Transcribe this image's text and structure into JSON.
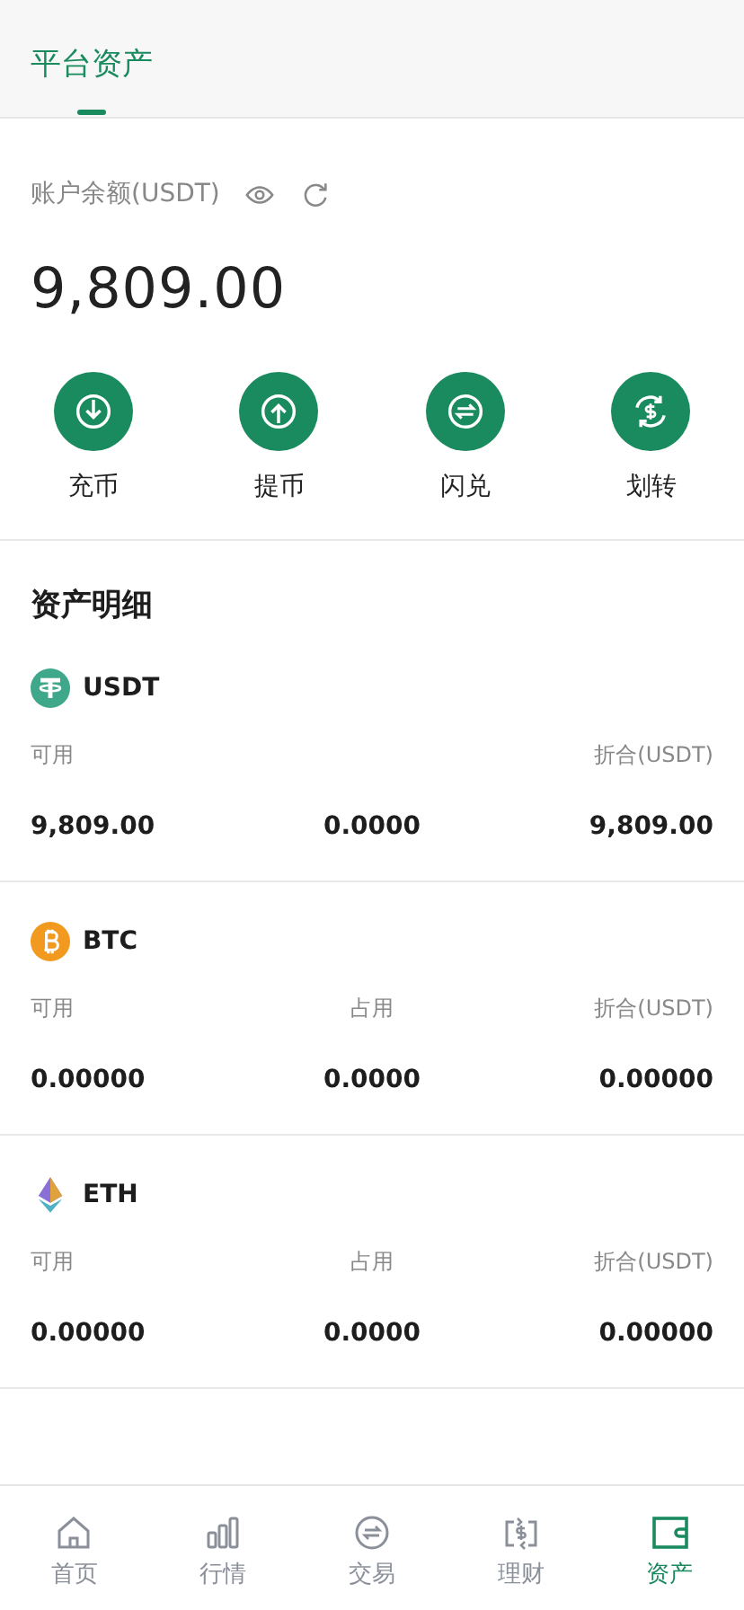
{
  "header": {
    "tabs": [
      {
        "label": "平台资产",
        "selected": true
      }
    ]
  },
  "balance": {
    "label": "账户余额(USDT)",
    "amount": "9,809.00"
  },
  "actions": [
    {
      "kind": "deposit",
      "label": "充币"
    },
    {
      "kind": "withdraw",
      "label": "提币"
    },
    {
      "kind": "swap",
      "label": "闪兑"
    },
    {
      "kind": "transfer",
      "label": "划转"
    }
  ],
  "assets": {
    "title": "资产明细",
    "items": [
      {
        "kind": "usdt",
        "name": "USDT",
        "columns": [
          {
            "label": "可用",
            "value": "9,809.00"
          },
          {
            "value": "0.0000"
          },
          {
            "label": "折合(USDT)",
            "value": "9,809.00"
          }
        ]
      },
      {
        "kind": "btc",
        "name": "BTC",
        "columns": [
          {
            "label": "可用",
            "value": "0.00000"
          },
          {
            "label": "占用",
            "value": "0.0000"
          },
          {
            "label": "折合(USDT)",
            "value": "0.00000"
          }
        ]
      },
      {
        "kind": "eth",
        "name": "ETH",
        "columns": [
          {
            "label": "可用",
            "value": "0.00000"
          },
          {
            "label": "占用",
            "value": "0.0000"
          },
          {
            "label": "折合(USDT)",
            "value": "0.00000"
          }
        ]
      }
    ]
  },
  "nav": [
    {
      "kind": "home",
      "label": "首页",
      "selected": false
    },
    {
      "kind": "market",
      "label": "行情",
      "selected": false
    },
    {
      "kind": "trade",
      "label": "交易",
      "selected": false
    },
    {
      "kind": "finance",
      "label": "理财",
      "selected": false
    },
    {
      "kind": "assets",
      "label": "资产",
      "selected": true
    }
  ]
}
